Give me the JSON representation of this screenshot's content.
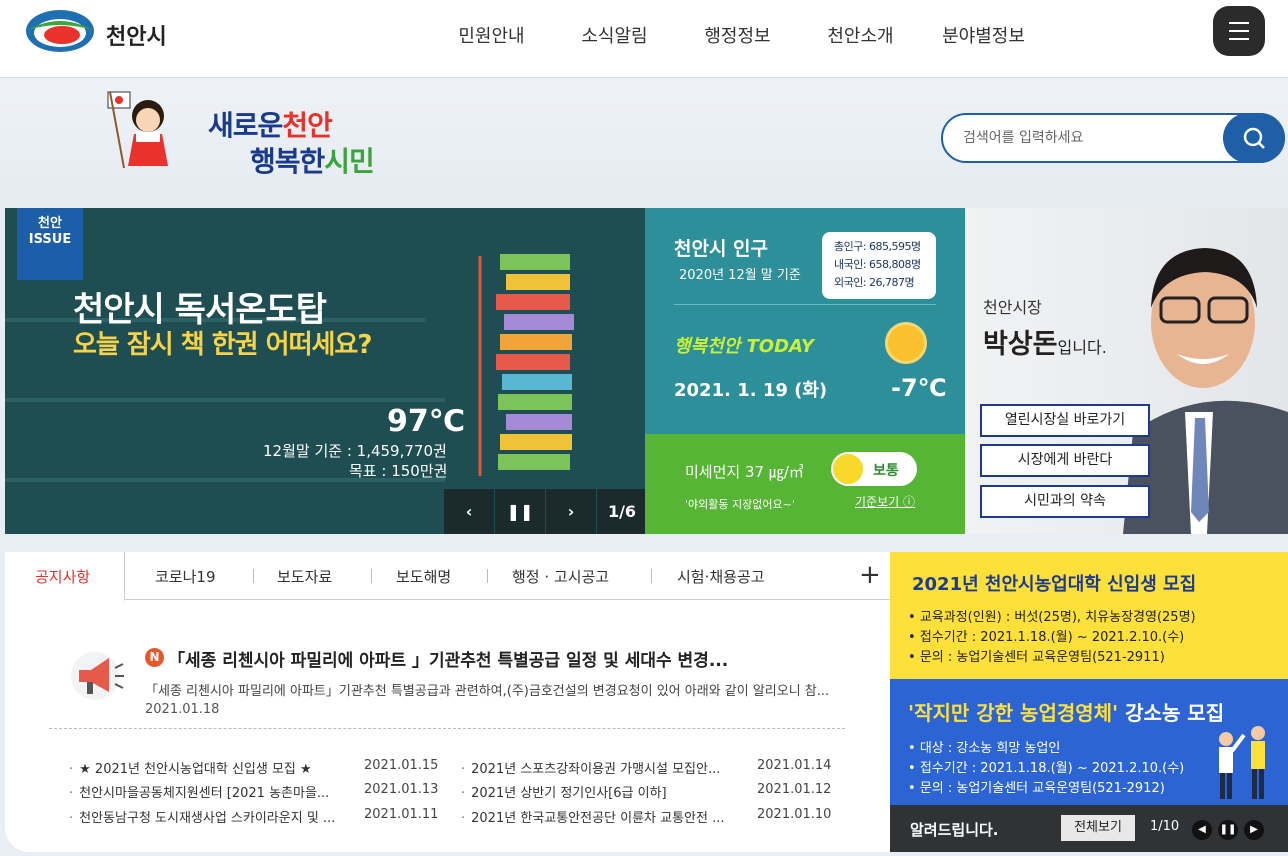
{
  "header": {
    "logo_text": "천안시",
    "nav": [
      "민원안내",
      "소식알림",
      "행정정보",
      "천안소개",
      "분야별정보"
    ],
    "menu_icon": "hamburger-icon"
  },
  "visual": {
    "slogan_line1_a": "새로운",
    "slogan_line1_b": "천안",
    "slogan_line2_a": "행복한",
    "slogan_line2_b": "시민",
    "search_placeholder": "검색어를 입력하세요",
    "search_icon": "search-icon"
  },
  "issue": {
    "badge_line1": "천안",
    "badge_line2": "ISSUE",
    "title": "천안시 독서온도탑",
    "subtitle": "오늘 잠시 책 한권 어떠세요?",
    "temperature": "97℃",
    "line1": "12월말 기준 : 1,459,770권",
    "line2": "목표 : 150만권",
    "page": "1/6",
    "prev_icon": "chevron-left-icon",
    "pause_icon": "pause-icon",
    "next_icon": "chevron-right-icon"
  },
  "population": {
    "title": "천안시 인구",
    "date": "2020년 12월 말 기준",
    "total": "총인구: 685,595명",
    "domestic": "내국인: 658,808명",
    "foreign": "외국인: 26,787명"
  },
  "weather": {
    "today_label": "행복천안 TODAY",
    "date": "2021. 1. 19 (화)",
    "temperature": "-7℃",
    "icon": "sun-icon"
  },
  "dust": {
    "label": "미세먼지 37 ㎍/㎥",
    "status": "보통",
    "note": "'야외활동 지장없어요~'",
    "link": "기준보기",
    "info_icon": "info-icon"
  },
  "mayor": {
    "subtitle": "천안시장",
    "name": "박상돈",
    "suffix": "입니다.",
    "buttons": [
      "열린시장실 바로가기",
      "시장에게 바란다",
      "시민과의 약속"
    ]
  },
  "notice": {
    "tabs": [
      "공지사항",
      "코로나19",
      "보도자료",
      "보도해명",
      "행정 · 고시공고",
      "시험·채용공고"
    ],
    "more": "+",
    "new_badge": "N",
    "featured_title": "「세종 리첸시아 파밀리에 아파트 」기관추천 특별공급 일정 및 세대수 변경...",
    "featured_desc": "「세종 리첸시아 파밀리에 아파트」기관추천 특별공급과 관련하여,(주)금호건설의 변경요청이 있어 아래와 같이 알리오니 참...",
    "featured_date": "2021.01.18",
    "list_left": [
      {
        "title": "★ 2021년 천안시농업대학 신입생 모집 ★",
        "date": "2021.01.15"
      },
      {
        "title": "천안시마을공동체지원센터 [2021 농촌마을...",
        "date": "2021.01.13"
      },
      {
        "title": "천안동남구청 도시재생사업 스카이라운지 및 ...",
        "date": "2021.01.11"
      }
    ],
    "list_right": [
      {
        "title": "2021년 스포츠강좌이용권 가맹시설 모집안...",
        "date": "2021.01.14"
      },
      {
        "title": "2021년 상반기 정기인사[6급 이하]",
        "date": "2021.01.12"
      },
      {
        "title": "2021년 한국교통안전공단 이륜차 교통안전 ...",
        "date": "2021.01.10"
      }
    ]
  },
  "promo1": {
    "title": "2021년 천안시농업대학 신입생 모집",
    "items": [
      "교육과정(인원) : 버섯(25명), 치유농장경영(25명)",
      "접수기간 : 2021.1.18.(월) ~ 2021.2.10.(수)",
      "문의 : 농업기술센터 교육운영팀(521-2911)"
    ]
  },
  "promo2": {
    "title_a": "'작지만 강한 농업경영체'",
    "title_b": "강소농 모집",
    "items": [
      "대상 : 강소농 희망 농업인",
      "접수기간 : 2021.1.18.(월) ~ 2021.2.10.(수)",
      "문의 : 농업기술센터 교육운영팀(521-2912)"
    ]
  },
  "promo_bar": {
    "title": "알려드립니다.",
    "view_all": "전체보기",
    "page": "1/10"
  },
  "colors": {
    "primary": "#1f5fa8",
    "issue_bg": "#1e4e52",
    "population_bg": "#2d8f99",
    "dust_bg": "#57b535",
    "promo_yellow": "#fee03b",
    "promo_blue": "#2d64d4",
    "active_tab": "#e8322b"
  }
}
